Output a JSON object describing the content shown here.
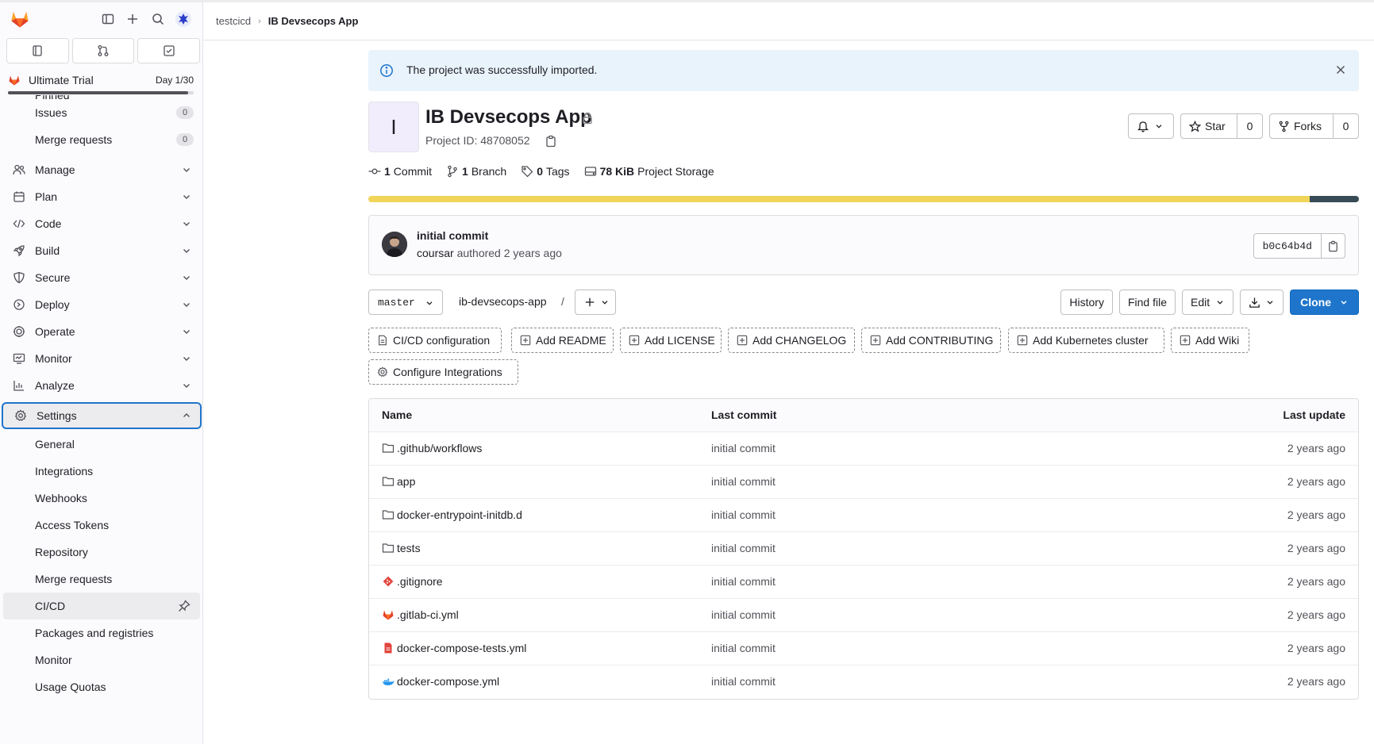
{
  "breadcrumb": {
    "group": "testcicd",
    "project": "IB Devsecops App"
  },
  "sidebar": {
    "trial": {
      "name": "Ultimate Trial",
      "day": "Day 1/30",
      "progress": 0.97
    },
    "pinned_label": "Pinned",
    "pinned_items": [
      {
        "label": "Issues",
        "count": "0"
      },
      {
        "label": "Merge requests",
        "count": "0"
      }
    ],
    "sections": [
      {
        "label": "Manage",
        "icon": "users-icon"
      },
      {
        "label": "Plan",
        "icon": "calendar-icon"
      },
      {
        "label": "Code",
        "icon": "code-icon"
      },
      {
        "label": "Build",
        "icon": "rocket-icon"
      },
      {
        "label": "Secure",
        "icon": "shield-icon"
      },
      {
        "label": "Deploy",
        "icon": "deploy-icon"
      },
      {
        "label": "Operate",
        "icon": "cloud-gear-icon"
      },
      {
        "label": "Monitor",
        "icon": "monitor-icon"
      },
      {
        "label": "Analyze",
        "icon": "chart-icon"
      }
    ],
    "settings": {
      "label": "Settings",
      "items": [
        "General",
        "Integrations",
        "Webhooks",
        "Access Tokens",
        "Repository",
        "Merge requests",
        "CI/CD",
        "Packages and registries",
        "Monitor",
        "Usage Quotas"
      ],
      "active": "CI/CD"
    }
  },
  "alert": {
    "text": "The project was successfully imported."
  },
  "project": {
    "avatar_letter": "I",
    "name": "IB Devsecops App",
    "id_label": "Project ID: 48708052",
    "star_label": "Star",
    "star_count": "0",
    "forks_label": "Forks",
    "forks_count": "0"
  },
  "stats": [
    {
      "num": "1",
      "label": "Commit"
    },
    {
      "num": "1",
      "label": "Branch"
    },
    {
      "num": "0",
      "label": "Tags"
    },
    {
      "num": "78 KiB",
      "label": "Project Storage"
    }
  ],
  "languages": {
    "colors": [
      "#f1d559",
      "#384b56"
    ],
    "shares": [
      0.95,
      0.05
    ]
  },
  "last_commit": {
    "title": "initial commit",
    "author": "coursar",
    "action": "authored",
    "when": "2 years ago",
    "sha": "b0c64b4d"
  },
  "repo_controls": {
    "branch": "master",
    "path": "ib-devsecops-app",
    "path_sep": "/",
    "history": "History",
    "find_file": "Find file",
    "edit": "Edit",
    "clone": "Clone"
  },
  "shortcuts": [
    "CI/CD configuration",
    "Add README",
    "Add LICENSE",
    "Add CHANGELOG",
    "Add CONTRIBUTING",
    "Add Kubernetes cluster",
    "Add Wiki",
    "Configure Integrations"
  ],
  "file_table": {
    "headers": {
      "name": "Name",
      "commit": "Last commit",
      "update": "Last update"
    },
    "rows": [
      {
        "name": ".github/workflows",
        "icon": "folder-icon",
        "commit": "initial commit",
        "update": "2 years ago"
      },
      {
        "name": "app",
        "icon": "folder-icon",
        "commit": "initial commit",
        "update": "2 years ago"
      },
      {
        "name": "docker-entrypoint-initdb.d",
        "icon": "folder-icon",
        "commit": "initial commit",
        "update": "2 years ago"
      },
      {
        "name": "tests",
        "icon": "folder-icon",
        "commit": "initial commit",
        "update": "2 years ago"
      },
      {
        "name": ".gitignore",
        "icon": "git-icon",
        "commit": "initial commit",
        "update": "2 years ago"
      },
      {
        "name": ".gitlab-ci.yml",
        "icon": "gitlab-icon",
        "commit": "initial commit",
        "update": "2 years ago"
      },
      {
        "name": "docker-compose-tests.yml",
        "icon": "yaml-file-icon",
        "commit": "initial commit",
        "update": "2 years ago"
      },
      {
        "name": "docker-compose.yml",
        "icon": "docker-icon",
        "commit": "initial commit",
        "update": "2 years ago"
      }
    ]
  }
}
